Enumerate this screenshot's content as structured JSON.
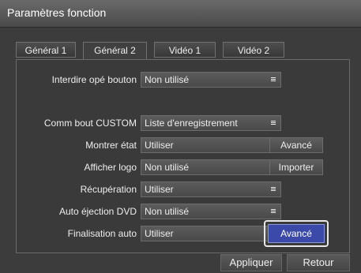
{
  "window": {
    "title": "Paramètres fonction"
  },
  "tabs": [
    {
      "label": "Général 1",
      "active": false
    },
    {
      "label": "Général 2",
      "active": true
    },
    {
      "label": "Vidéo 1",
      "active": false
    },
    {
      "label": "Vidéo 2",
      "active": false
    }
  ],
  "settings": [
    {
      "label": "Interdire opé bouton",
      "value": "Non utilisé"
    },
    {
      "label": "Comm bout CUSTOM",
      "value": "Liste d'enregistrement"
    },
    {
      "label": "Montrer état",
      "value": "Utiliser",
      "button": "Avancé"
    },
    {
      "label": "Afficher logo",
      "value": "Non utilisé",
      "button": "Importer"
    },
    {
      "label": "Récupération",
      "value": "Utiliser"
    },
    {
      "label": "Auto éjection DVD",
      "value": "Non utilisé"
    },
    {
      "label": "Finalisation auto",
      "value": "Utiliser",
      "button": "Avancé",
      "focused": true
    }
  ],
  "footer": {
    "apply_label": "Appliquer",
    "back_label": "Retour"
  },
  "colors": {
    "accent": "#3b4aa8",
    "background": "#3c3c3c",
    "titlebar": "#5a5a5a"
  },
  "icons": {
    "dropdown": "list-menu-icon"
  }
}
